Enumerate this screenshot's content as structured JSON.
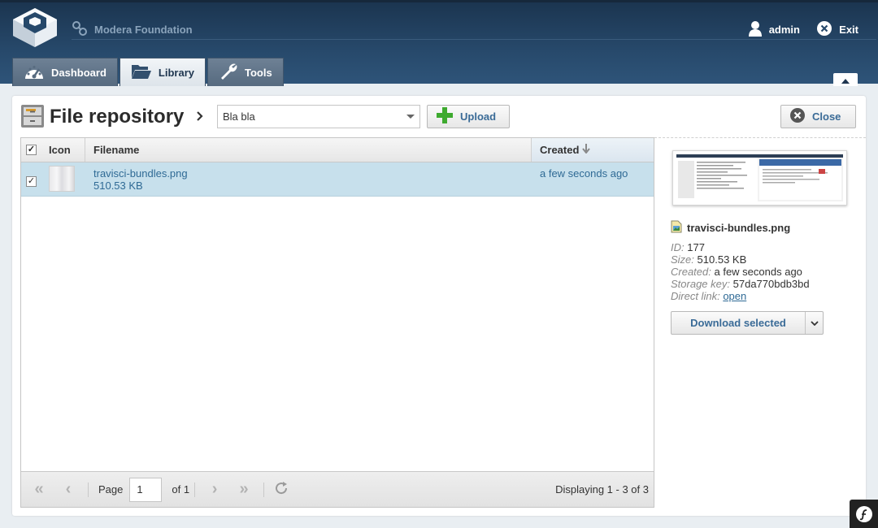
{
  "header": {
    "brand": "Modera Foundation",
    "user": "admin",
    "exit_label": "Exit",
    "tabs": [
      {
        "label": "Dashboard",
        "icon": "dashboard-gauge-icon"
      },
      {
        "label": "Library",
        "icon": "folder-open-icon"
      },
      {
        "label": "Tools",
        "icon": "wrench-icon"
      }
    ]
  },
  "repository": {
    "title": "File repository",
    "combo_value": "Bla bla",
    "upload_label": "Upload",
    "close_label": "Close"
  },
  "grid": {
    "columns": [
      "Icon",
      "Filename",
      "Created"
    ],
    "rows": [
      {
        "filename": "travisci-bundles.png",
        "size": "510.53 KB",
        "created": "a few seconds ago",
        "selected": true
      }
    ],
    "pager": {
      "page_label": "Page",
      "page_value": "1",
      "of_label": "of 1",
      "displaying": "Displaying 1 - 3 of 3"
    }
  },
  "detail": {
    "filename": "travisci-bundles.png",
    "id_key": "ID:",
    "id_value": "177",
    "size_key": "Size:",
    "size_value": "510.53 KB",
    "created_key": "Created:",
    "created_value": "a few seconds ago",
    "storage_key": "Storage key:",
    "storage_value": "57da770bdb3bd",
    "link_key": "Direct link:",
    "link_value": "open",
    "download_label": "Download selected"
  },
  "colors": {
    "header_bg": "#27496b",
    "selected_row": "#c7e0ec",
    "link": "#2f6a95",
    "upload_plus": "#3eaa2f"
  }
}
